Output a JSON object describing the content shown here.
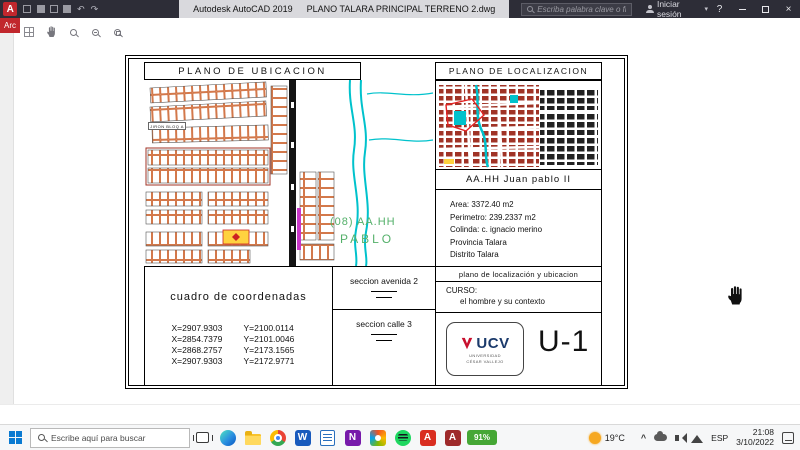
{
  "colors": {
    "titlebar_bg": "#2d2d37",
    "accent_red": "#c1272d",
    "parcel_orange": "#c8571e",
    "water_cyan": "#00c2cc",
    "map_green": "#54b06a",
    "block_darkred": "#a03326",
    "battery_green": "#45a735",
    "taskbar_bg": "#f6f7f8",
    "start_blue": "#0a7ad1"
  },
  "icons": {
    "autocad_logo_glyph": "A",
    "undo_glyph": "↶",
    "redo_glyph": "↷",
    "caret_glyph": "▾",
    "close_glyph": "×",
    "help_glyph": "?",
    "tray_chevron_glyph": "^",
    "word_glyph": "W",
    "onenote_glyph": "N",
    "acrobat_glyph": "A",
    "autocad_app_glyph": "A"
  },
  "titlebar": {
    "app_title": "Autodesk AutoCAD 2019",
    "doc_title": "PLANO TALARA PRINCIPAL TERRENO 2.dwg",
    "search_placeholder": "Escriba palabra clave o frase",
    "sign_in_label": "Iniciar sesión"
  },
  "file_menu_label": "Arc",
  "sheet": {
    "ubicacion_title": "PLANO DE UBICACION",
    "localizacion_title": "PLANO DE LOCALIZACION",
    "street_label": "JIRON BLOQ A",
    "map_label_1": "(08) AA.HH",
    "map_label_2": "PABLO",
    "aahh_title": "AA.HH Juan pablo II",
    "details": {
      "area": "Area: 3372.40 m2",
      "perimetro": "Perimetro: 239.2337 m2",
      "colinda": "Colinda: c. ignacio merino",
      "provincia": "Provincia Talara",
      "distrito": "Distrito Talara"
    },
    "coord_title": "cuadro de coordenadas",
    "coords": [
      {
        "x": "X=2907.9303",
        "y": "Y=2100.0114"
      },
      {
        "x": "X=2854.7379",
        "y": "Y=2101.0046"
      },
      {
        "x": "X=2868.2757",
        "y": "Y=2173.1565"
      },
      {
        "x": "X=2907.9303",
        "y": "Y=2172.9771"
      }
    ],
    "seccion_avenida_label": "seccion avenida 2",
    "seccion_calle_label": "seccion calle 3",
    "plano_label": "plano de localización y ubicacion",
    "curso_label": "CURSO:",
    "curso_value": "el hombre y su contexto",
    "logo_text": "UCV",
    "logo_caption_1": "UNIVERSIDAD",
    "logo_caption_2": "CÉSAR VALLEJO",
    "sheet_code": "U-1"
  },
  "taskbar": {
    "search_placeholder": "Escribe aquí para buscar",
    "battery_label": "91%",
    "weather_temp": "19°C",
    "language": "ESP",
    "time": "21:08",
    "date": "3/10/2022"
  }
}
